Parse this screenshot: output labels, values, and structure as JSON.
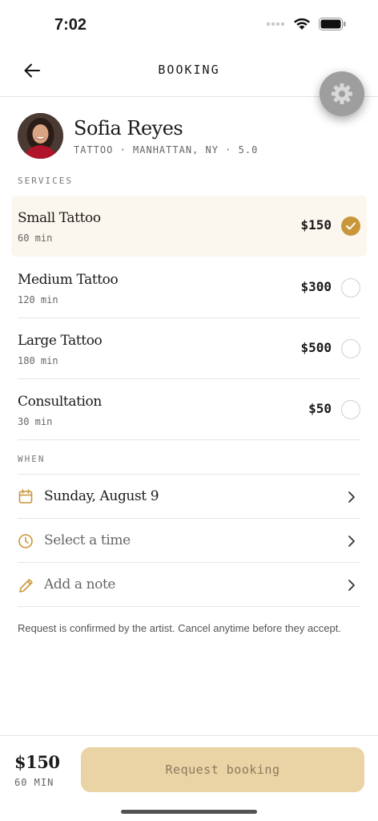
{
  "status_bar": {
    "time": "7:02"
  },
  "header": {
    "title": "BOOKING"
  },
  "artist": {
    "name": "Sofia Reyes",
    "meta": "TATTOO · MANHATTAN, NY · 5.0"
  },
  "services_label": "SERVICES",
  "services": [
    {
      "name": "Small Tattoo",
      "duration": "60 min",
      "price": "$150",
      "selected": true
    },
    {
      "name": "Medium Tattoo",
      "duration": "120 min",
      "price": "$300",
      "selected": false
    },
    {
      "name": "Large Tattoo",
      "duration": "180 min",
      "price": "$500",
      "selected": false
    },
    {
      "name": "Consultation",
      "duration": "30 min",
      "price": "$50",
      "selected": false
    }
  ],
  "when_label": "WHEN",
  "when": {
    "date": {
      "text": "Sunday, August 9",
      "icon": "calendar-icon"
    },
    "time": {
      "text": "Select a time",
      "icon": "clock-icon"
    },
    "note": {
      "text": "Add a note",
      "icon": "pencil-icon"
    }
  },
  "notice": "Request is confirmed by the artist. Cancel anytime before they accept.",
  "footer": {
    "price": "$150",
    "duration": "60 MIN",
    "button_label": "Request booking"
  },
  "colors": {
    "accent": "#c9963a",
    "selected_bg": "#fcf7ee",
    "button_disabled": "#ead3a4"
  }
}
